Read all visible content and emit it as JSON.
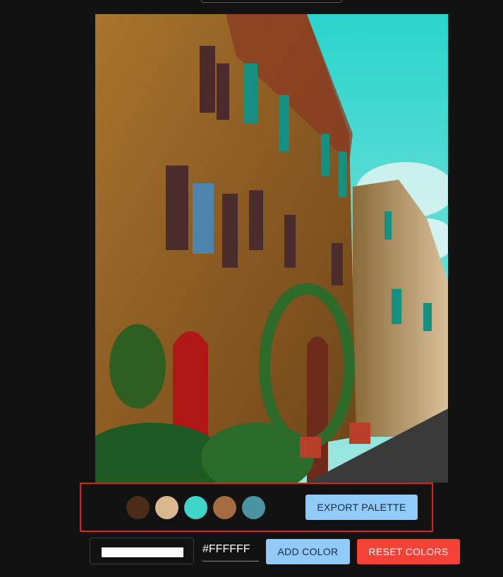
{
  "top_field": {
    "value": ""
  },
  "photo": {
    "alt": ""
  },
  "palette": {
    "swatches": [
      {
        "color": "#4a2c18"
      },
      {
        "color": "#d9b88e"
      },
      {
        "color": "#3fd6c9"
      },
      {
        "color": "#a56d3f"
      },
      {
        "color": "#4a94a2"
      }
    ],
    "export_label": "EXPORT PALETTE"
  },
  "controls": {
    "picker_color": "#FFFFFF",
    "hex_value": "#FFFFFF",
    "add_label": "ADD COLOR",
    "reset_label": "RESET COLORS"
  },
  "colors": {
    "background": "#121212",
    "highlight_border": "#e02020",
    "primary_button": "#90caf9",
    "danger_button": "#f44336"
  }
}
